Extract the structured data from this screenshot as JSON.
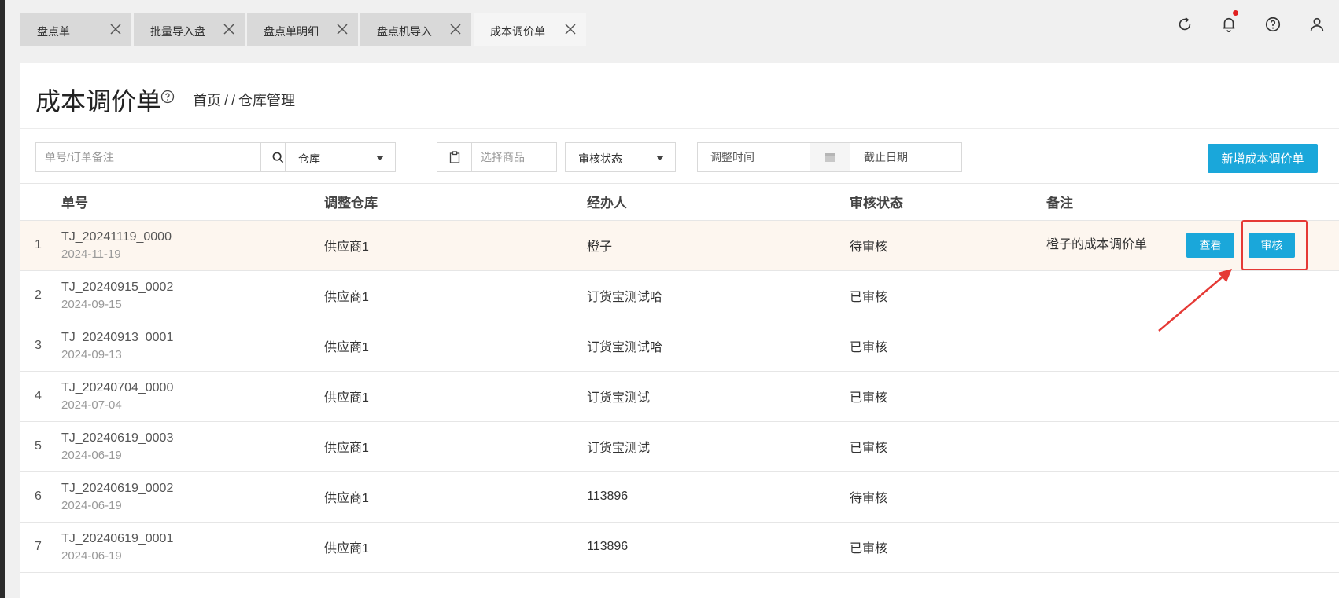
{
  "tabs": [
    {
      "label": "盘点单"
    },
    {
      "label": "批量导入盘"
    },
    {
      "label": "盘点单明细"
    },
    {
      "label": "盘点机导入"
    },
    {
      "label": "成本调价单",
      "active": true
    }
  ],
  "top_icons": [
    "refresh-icon",
    "bell-icon",
    "help-icon",
    "user-icon"
  ],
  "page": {
    "title": "成本调价单",
    "breadcrumb": [
      "首页",
      "/",
      "/",
      "仓库管理"
    ]
  },
  "filters": {
    "search_placeholder": "单号/订单备注",
    "warehouse_label": "仓库",
    "product_placeholder": "选择商品",
    "status_label": "审核状态",
    "start_placeholder": "调整时间",
    "end_placeholder": "截止日期",
    "add_button": "新增成本调价单"
  },
  "table": {
    "headers": [
      "单号",
      "调整仓库",
      "经办人",
      "审核状态",
      "备注"
    ],
    "rows": [
      {
        "idx": "1",
        "no": "TJ_20241119_0000",
        "date": "2024-11-19",
        "warehouse": "供应商1",
        "operator": "橙子",
        "status": "待审核",
        "remark": "橙子的成本调价单",
        "view": "查看",
        "audit": "审核"
      },
      {
        "idx": "2",
        "no": "TJ_20240915_0002",
        "date": "2024-09-15",
        "warehouse": "供应商1",
        "operator": "订货宝测试哈",
        "status": "已审核",
        "remark": ""
      },
      {
        "idx": "3",
        "no": "TJ_20240913_0001",
        "date": "2024-09-13",
        "warehouse": "供应商1",
        "operator": "订货宝测试哈",
        "status": "已审核",
        "remark": ""
      },
      {
        "idx": "4",
        "no": "TJ_20240704_0000",
        "date": "2024-07-04",
        "warehouse": "供应商1",
        "operator": "订货宝测试",
        "status": "已审核",
        "remark": ""
      },
      {
        "idx": "5",
        "no": "TJ_20240619_0003",
        "date": "2024-06-19",
        "warehouse": "供应商1",
        "operator": "订货宝测试",
        "status": "已审核",
        "remark": ""
      },
      {
        "idx": "6",
        "no": "TJ_20240619_0002",
        "date": "2024-06-19",
        "warehouse": "供应商1",
        "operator": "113896",
        "status": "待审核",
        "remark": ""
      },
      {
        "idx": "7",
        "no": "TJ_20240619_0001",
        "date": "2024-06-19",
        "warehouse": "供应商1",
        "operator": "113896",
        "status": "已审核",
        "remark": ""
      }
    ]
  },
  "colors": {
    "accent": "#1aa7da",
    "highlight_row": "#fdf6ef",
    "annotation": "#e53935",
    "notification_dot": "#e02020"
  }
}
